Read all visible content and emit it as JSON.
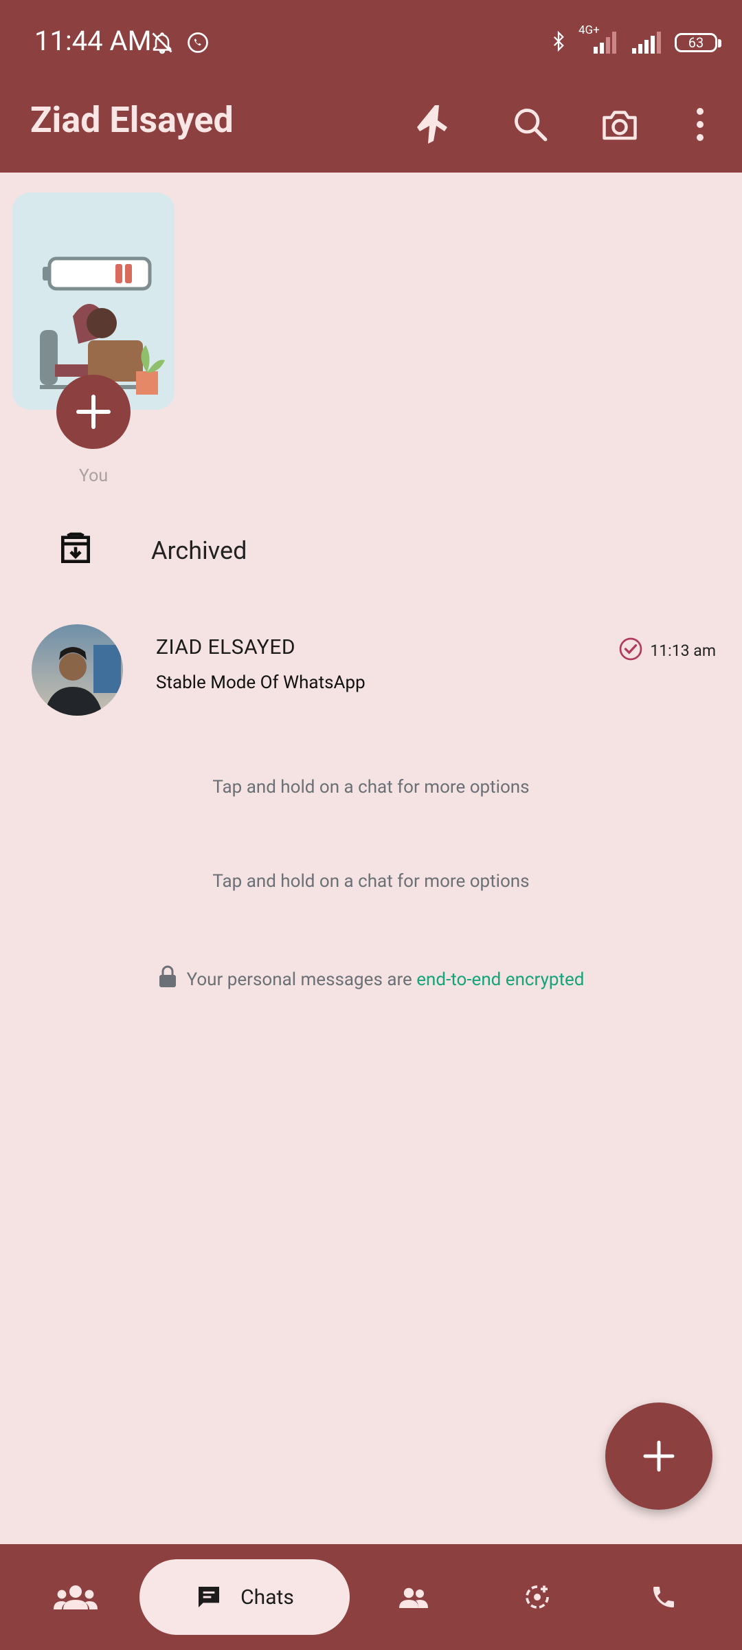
{
  "status_bar": {
    "time": "11:44 AM",
    "network": "4G+",
    "battery": "63",
    "icons": [
      "mute-icon",
      "whatsapp-icon",
      "bluetooth-icon",
      "signal-icon",
      "signal-icon",
      "battery-icon"
    ]
  },
  "header": {
    "title": "Ziad Elsayed",
    "icons": [
      "airplane-icon",
      "search-icon",
      "camera-icon",
      "more-icon"
    ]
  },
  "status": {
    "label": "You",
    "add_icon": "plus-icon"
  },
  "archived": {
    "label": "Archived",
    "icon": "archive-icon"
  },
  "chats": [
    {
      "name": "ZIAD ELSAYED",
      "preview": "Stable Mode Of WhatsApp",
      "time": "11:13 am",
      "status_icon": "check-circle-icon"
    }
  ],
  "hints": [
    "Tap and hold on a chat for more options",
    "Tap and hold on a chat for more options"
  ],
  "encryption": {
    "text": "Your personal messages are ",
    "link": "end-to-end encrypted"
  },
  "fab": {
    "icon": "plus-icon"
  },
  "bottom_nav": {
    "items": [
      {
        "name": "communities",
        "icon": "communities-icon"
      },
      {
        "name": "chats",
        "label": "Chats",
        "icon": "chat-icon",
        "selected": true
      },
      {
        "name": "contacts",
        "icon": "people-icon"
      },
      {
        "name": "updates",
        "icon": "status-icon"
      },
      {
        "name": "calls",
        "icon": "phone-icon"
      }
    ]
  },
  "colors": {
    "primary": "#8c4040",
    "background": "#f5e3e3",
    "link": "#15a37a",
    "header_text": "#fbe6e6"
  }
}
